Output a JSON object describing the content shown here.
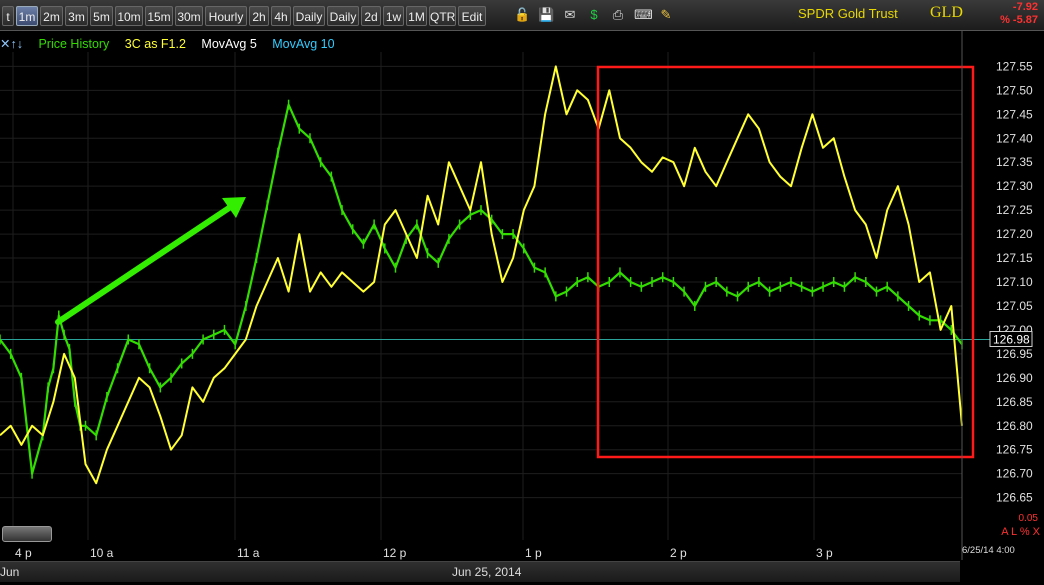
{
  "toolbar": {
    "timeframes": [
      "t",
      "1m",
      "2m",
      "3m",
      "5m",
      "10m",
      "15m",
      "30m",
      "Hourly",
      "2h",
      "4h",
      "Daily",
      "Daily",
      "2d",
      "1w",
      "1M",
      "QTR",
      "Edit"
    ],
    "active_index": 1,
    "icons": [
      "lock-icon",
      "save-icon",
      "mail-icon",
      "dollar-icon",
      "print-icon",
      "keyboard-icon",
      "pencil-icon"
    ]
  },
  "symbol": {
    "name": "SPDR Gold Trust",
    "ticker": "GLD",
    "change_abs": "-7.92",
    "change_pct": "% -5.87"
  },
  "legend": {
    "arrows": "✕↑↓",
    "price_history": "Price History",
    "indicator": "3C as F1.2",
    "ma5": "MovAvg 5",
    "ma10": "MovAvg 10",
    "colors": {
      "price": "#33dd00",
      "indicator": "#ffff33",
      "ma5": "#ffffff",
      "ma10": "#33ccff"
    }
  },
  "footer": {
    "date": "Jun 25, 2014",
    "left_label": "Jun",
    "timestamp": "6/25/14 4:00",
    "axis_value": "0.05",
    "axis_control": "A L % X"
  },
  "chart_data": {
    "type": "line",
    "x_tick_labels": [
      "4 p",
      "10 a",
      "11 a",
      "12 p",
      "1 p",
      "2 p",
      "3 p"
    ],
    "ylim": [
      126.62,
      127.58
    ],
    "y_tick_labels": [
      "127.55",
      "127.50",
      "127.45",
      "127.40",
      "127.35",
      "127.30",
      "127.25",
      "127.20",
      "127.15",
      "127.10",
      "127.05",
      "127.00",
      "126.95",
      "126.90",
      "126.85",
      "126.80",
      "126.75",
      "126.70",
      "126.65"
    ],
    "last_price": "126.98",
    "reference_level": 126.98,
    "series": [
      {
        "name": "Price History",
        "color": "#33dd00",
        "x": [
          0,
          2,
          4,
          6,
          8,
          9,
          10,
          11,
          12,
          13,
          14,
          15,
          16,
          18,
          20,
          22,
          24,
          26,
          28,
          30,
          32,
          34,
          36,
          38,
          40,
          42,
          44,
          46,
          48,
          50,
          52,
          54,
          56,
          58,
          60,
          62,
          64,
          66,
          68,
          70,
          72,
          74,
          76,
          78,
          80,
          82,
          84,
          86,
          88,
          90,
          92,
          94,
          96,
          98,
          100,
          102,
          104,
          106,
          108,
          110,
          112,
          114,
          116,
          118,
          120,
          122,
          124,
          126,
          128,
          130,
          132,
          134,
          136,
          138,
          140,
          142,
          144,
          146,
          148,
          150,
          152,
          154,
          156,
          158,
          160,
          162,
          164,
          166,
          168,
          170,
          172,
          174,
          176,
          178,
          180
        ],
        "y": [
          126.98,
          126.95,
          126.9,
          126.7,
          126.78,
          126.88,
          126.92,
          127.03,
          126.99,
          126.96,
          126.85,
          126.8,
          126.8,
          126.78,
          126.86,
          126.92,
          126.98,
          126.97,
          126.92,
          126.88,
          126.9,
          126.93,
          126.95,
          126.98,
          126.99,
          127.0,
          126.97,
          127.05,
          127.15,
          127.26,
          127.37,
          127.47,
          127.42,
          127.4,
          127.35,
          127.32,
          127.25,
          127.21,
          127.18,
          127.22,
          127.17,
          127.13,
          127.19,
          127.22,
          127.16,
          127.14,
          127.19,
          127.22,
          127.24,
          127.25,
          127.23,
          127.2,
          127.2,
          127.17,
          127.13,
          127.12,
          127.07,
          127.08,
          127.1,
          127.11,
          127.09,
          127.1,
          127.12,
          127.1,
          127.09,
          127.1,
          127.11,
          127.1,
          127.08,
          127.05,
          127.09,
          127.1,
          127.08,
          127.07,
          127.09,
          127.1,
          127.08,
          127.09,
          127.1,
          127.09,
          127.08,
          127.09,
          127.1,
          127.09,
          127.11,
          127.1,
          127.08,
          127.09,
          127.07,
          127.05,
          127.03,
          127.02,
          127.02,
          127.0,
          126.97
        ]
      },
      {
        "name": "3C as F1.2",
        "color": "#ffff33",
        "x": [
          0,
          2,
          4,
          6,
          8,
          10,
          12,
          14,
          16,
          18,
          20,
          22,
          24,
          26,
          28,
          30,
          32,
          34,
          36,
          38,
          40,
          42,
          44,
          46,
          48,
          50,
          52,
          54,
          56,
          58,
          60,
          62,
          64,
          66,
          68,
          70,
          72,
          74,
          76,
          78,
          80,
          82,
          84,
          86,
          88,
          90,
          92,
          94,
          96,
          98,
          100,
          102,
          104,
          106,
          108,
          110,
          112,
          114,
          116,
          118,
          120,
          122,
          124,
          126,
          128,
          130,
          132,
          134,
          136,
          138,
          140,
          142,
          144,
          146,
          148,
          150,
          152,
          154,
          156,
          158,
          160,
          162,
          164,
          166,
          168,
          170,
          172,
          174,
          176,
          178,
          180
        ],
        "y": [
          126.78,
          126.8,
          126.76,
          126.8,
          126.78,
          126.85,
          126.95,
          126.9,
          126.72,
          126.68,
          126.75,
          126.8,
          126.85,
          126.9,
          126.88,
          126.82,
          126.75,
          126.78,
          126.88,
          126.85,
          126.9,
          126.92,
          126.95,
          126.98,
          127.05,
          127.1,
          127.15,
          127.08,
          127.2,
          127.08,
          127.12,
          127.09,
          127.12,
          127.1,
          127.08,
          127.1,
          127.22,
          127.25,
          127.2,
          127.15,
          127.28,
          127.22,
          127.35,
          127.3,
          127.25,
          127.35,
          127.2,
          127.1,
          127.15,
          127.25,
          127.3,
          127.45,
          127.55,
          127.45,
          127.5,
          127.48,
          127.42,
          127.5,
          127.4,
          127.38,
          127.35,
          127.33,
          127.36,
          127.35,
          127.3,
          127.38,
          127.33,
          127.3,
          127.35,
          127.4,
          127.45,
          127.42,
          127.35,
          127.32,
          127.3,
          127.38,
          127.45,
          127.38,
          127.4,
          127.32,
          127.25,
          127.22,
          127.15,
          127.25,
          127.3,
          127.22,
          127.1,
          127.12,
          127.0,
          127.05,
          126.8
        ]
      }
    ]
  }
}
